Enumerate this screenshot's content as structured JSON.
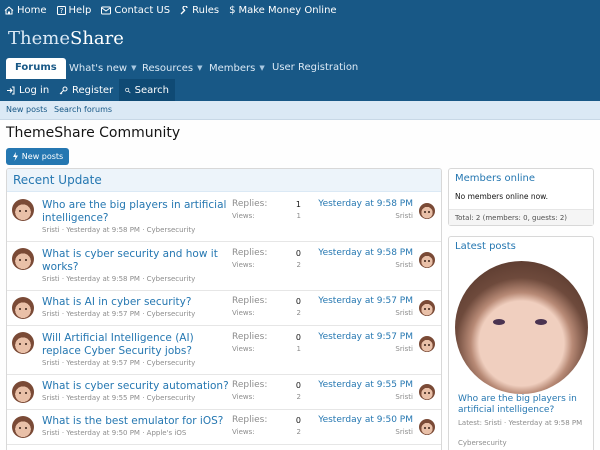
{
  "topbar": {
    "links": [
      {
        "label": "Home",
        "icon": "home-icon"
      },
      {
        "label": "Help",
        "icon": "help-icon"
      },
      {
        "label": "Contact US",
        "icon": "mail-icon"
      },
      {
        "label": "Rules",
        "icon": "wrench-icon"
      },
      {
        "label": "Make Money Online",
        "icon": "dollar-icon"
      }
    ]
  },
  "logo": {
    "part1": "Theme",
    "part2": "Share"
  },
  "nav": {
    "forums": "Forums",
    "whats_new": "What's new",
    "resources": "Resources",
    "members": "Members",
    "user_registration": "User Registration"
  },
  "account": {
    "login": "Log in",
    "register": "Register",
    "search": "Search"
  },
  "subnav": {
    "new_posts": "New posts",
    "search_forums": "Search forums"
  },
  "page": {
    "title": "ThemeShare Community",
    "new_posts_button": "New posts"
  },
  "recent": {
    "heading": "Recent Update",
    "replies_label": "Replies:",
    "views_label": "Views:",
    "threads": [
      {
        "title": "Who are the big players in artificial intelligence?",
        "author": "Sristi",
        "date": "Yesterday at 9:58 PM",
        "forum": "Cybersecurity",
        "replies": "1",
        "views": "1",
        "last_date": "Yesterday at 9:58 PM",
        "last_user": "Sristi"
      },
      {
        "title": "What is cyber security and how it works?",
        "author": "Sristi",
        "date": "Yesterday at 9:58 PM",
        "forum": "Cybersecurity",
        "replies": "0",
        "views": "2",
        "last_date": "Yesterday at 9:58 PM",
        "last_user": "Sristi"
      },
      {
        "title": "What is AI in cyber security?",
        "author": "Sristi",
        "date": "Yesterday at 9:57 PM",
        "forum": "Cybersecurity",
        "replies": "0",
        "views": "2",
        "last_date": "Yesterday at 9:57 PM",
        "last_user": "Sristi"
      },
      {
        "title": "Will Artificial Intelligence (AI) replace Cyber Security jobs?",
        "author": "Sristi",
        "date": "Yesterday at 9:57 PM",
        "forum": "Cybersecurity",
        "replies": "0",
        "views": "1",
        "last_date": "Yesterday at 9:57 PM",
        "last_user": "Sristi"
      },
      {
        "title": "What is cyber security automation?",
        "author": "Sristi",
        "date": "Yesterday at 9:55 PM",
        "forum": "Cybersecurity",
        "replies": "0",
        "views": "2",
        "last_date": "Yesterday at 9:55 PM",
        "last_user": "Sristi"
      },
      {
        "title": "What is the best emulator for iOS?",
        "author": "Sristi",
        "date": "Yesterday at 9:50 PM",
        "forum": "Apple's iOS",
        "replies": "0",
        "views": "2",
        "last_date": "Yesterday at 9:50 PM",
        "last_user": "Sristi"
      }
    ]
  },
  "members_online": {
    "heading": "Members online",
    "message": "No members online now.",
    "total": "Total: 2 (members: 0, guests: 2)"
  },
  "latest_posts": {
    "heading": "Latest posts",
    "title": "Who are the big players in artificial intelligence?",
    "meta": "Latest: Sristi · Yesterday at 9:58 PM",
    "forum": "Cybersecurity"
  },
  "colors": {
    "brand": "#185886",
    "accent": "#2577b1",
    "light": "#dbe9f5"
  }
}
